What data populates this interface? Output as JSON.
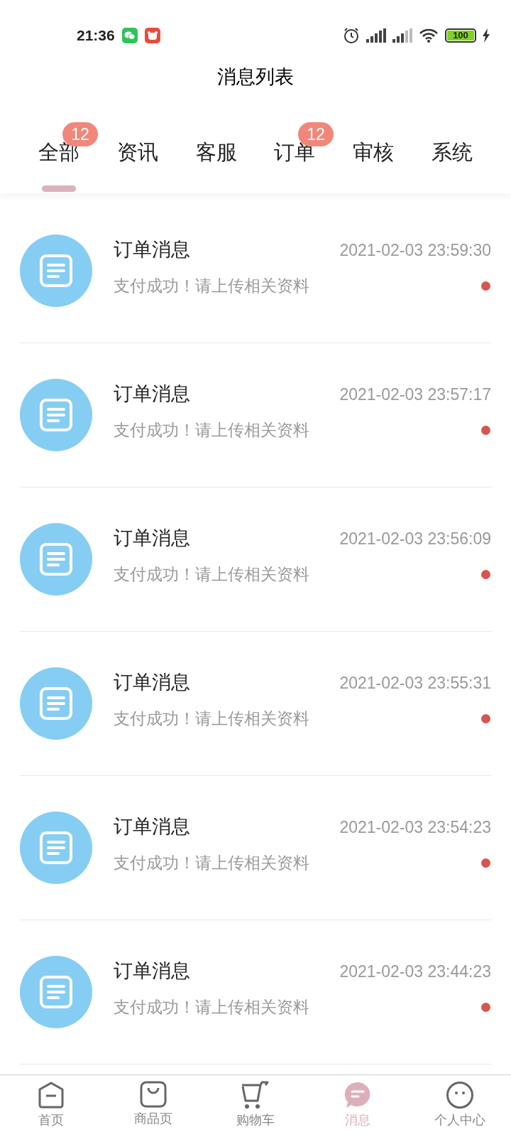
{
  "status_bar": {
    "time": "21:36",
    "battery": "100"
  },
  "title": "消息列表",
  "tabs": [
    {
      "label": "全部",
      "selected": true,
      "badge": "12"
    },
    {
      "label": "资讯",
      "selected": false
    },
    {
      "label": "客服",
      "selected": false
    },
    {
      "label": "订单",
      "selected": false,
      "badge": "12"
    },
    {
      "label": "审核",
      "selected": false
    },
    {
      "label": "系统",
      "selected": false
    }
  ],
  "messages": [
    {
      "title": "订单消息",
      "time": "2021-02-03 23:59:30",
      "text": "支付成功！请上传相关资料",
      "unread": true
    },
    {
      "title": "订单消息",
      "time": "2021-02-03 23:57:17",
      "text": "支付成功！请上传相关资料",
      "unread": true
    },
    {
      "title": "订单消息",
      "time": "2021-02-03 23:56:09",
      "text": "支付成功！请上传相关资料",
      "unread": true
    },
    {
      "title": "订单消息",
      "time": "2021-02-03 23:55:31",
      "text": "支付成功！请上传相关资料",
      "unread": true
    },
    {
      "title": "订单消息",
      "time": "2021-02-03 23:54:23",
      "text": "支付成功！请上传相关资料",
      "unread": true
    },
    {
      "title": "订单消息",
      "time": "2021-02-03 23:44:23",
      "text": "支付成功！请上传相关资料",
      "unread": true
    }
  ],
  "nav": [
    {
      "kind": "home",
      "label": "首页",
      "selected": false
    },
    {
      "kind": "bag",
      "label": "商品页",
      "selected": false
    },
    {
      "kind": "cart",
      "label": "购物车",
      "selected": false
    },
    {
      "kind": "message",
      "label": "消息",
      "selected": true
    },
    {
      "kind": "user",
      "label": "个人中心",
      "selected": false
    }
  ]
}
